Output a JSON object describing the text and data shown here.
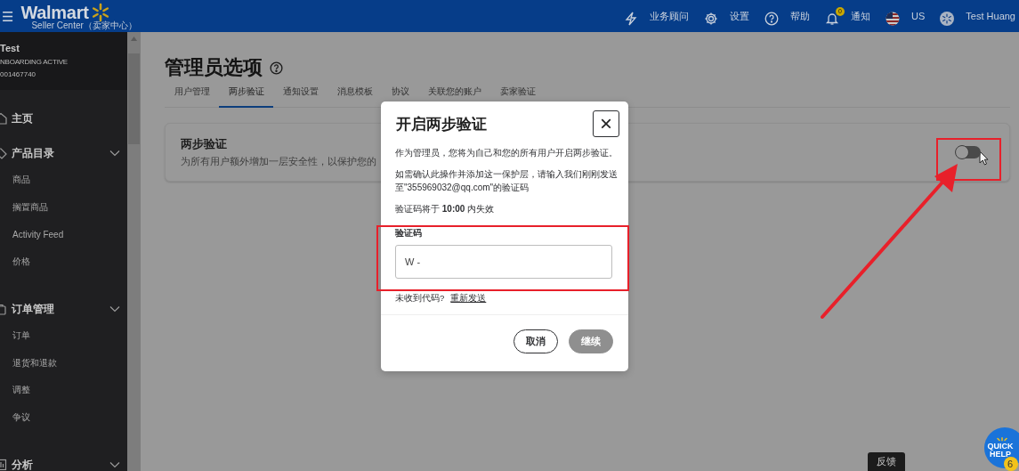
{
  "header": {
    "menu_glyph": "☰",
    "brand": "Walmart",
    "subtitle": "Seller Center（卖家中心）",
    "actions": [
      {
        "kind": "advisor",
        "label": "业务顾问"
      },
      {
        "kind": "settings",
        "label": "设置"
      },
      {
        "kind": "help",
        "label": "帮助"
      },
      {
        "kind": "notifications",
        "label": "通知",
        "badge": "0"
      },
      {
        "kind": "region",
        "label": "US"
      },
      {
        "kind": "user",
        "label": "Test Huang"
      }
    ]
  },
  "sidebar": {
    "account": {
      "name": "Test",
      "status": "NBOARDING ACTIVE",
      "id": "001467740"
    },
    "groups": [
      {
        "kind": "link",
        "label": "主页"
      },
      {
        "kind": "group",
        "label": "产品目录",
        "children": [
          "商品",
          "搁置商品",
          "Activity Feed",
          "价格"
        ]
      },
      {
        "kind": "group",
        "label": "订单管理",
        "children": [
          "订单",
          "退货和退款",
          "调整",
          "争议"
        ]
      },
      {
        "kind": "group",
        "label": "分析"
      }
    ]
  },
  "page": {
    "title": "管理员选项",
    "tabs": [
      {
        "label": "用户管理",
        "selected": false
      },
      {
        "label": "两步验证",
        "selected": true
      },
      {
        "label": "通知设置",
        "selected": false
      },
      {
        "label": "消息模板",
        "selected": false
      },
      {
        "label": "协议",
        "selected": false
      },
      {
        "label": "关联您的账户",
        "selected": false
      },
      {
        "label": "卖家验证",
        "selected": false
      }
    ],
    "card": {
      "title": "两步验证",
      "description": "为所有用户额外增加一层安全性，以保护您的",
      "toggle_on": false
    }
  },
  "dialog": {
    "title": "开启两步验证",
    "close_glyph": "×",
    "paragraphs": [
      "作为管理员，您将为自己和您的所有用户开启两步验证。",
      "如需确认此操作并添加这一保护层，请输入我们刚刚发送至\"355969032@qq.com\"的验证码",
      "验证码将于 **10:00** 内失效"
    ],
    "field": {
      "label": "验证码",
      "value": "W -"
    },
    "resend_prompt": "未收到代码?",
    "resend_link": "重新发送",
    "buttons": [
      {
        "label": "取消",
        "disabled": false
      },
      {
        "label": "继续",
        "disabled": true
      }
    ]
  },
  "annotations": [
    {
      "kind": "frame"
    },
    {
      "kind": "frame"
    },
    {
      "kind": "arrow"
    }
  ],
  "feedback": "反馈",
  "quick_help": {
    "lines": [
      "QUICK",
      "HELP"
    ],
    "badge": "6"
  }
}
